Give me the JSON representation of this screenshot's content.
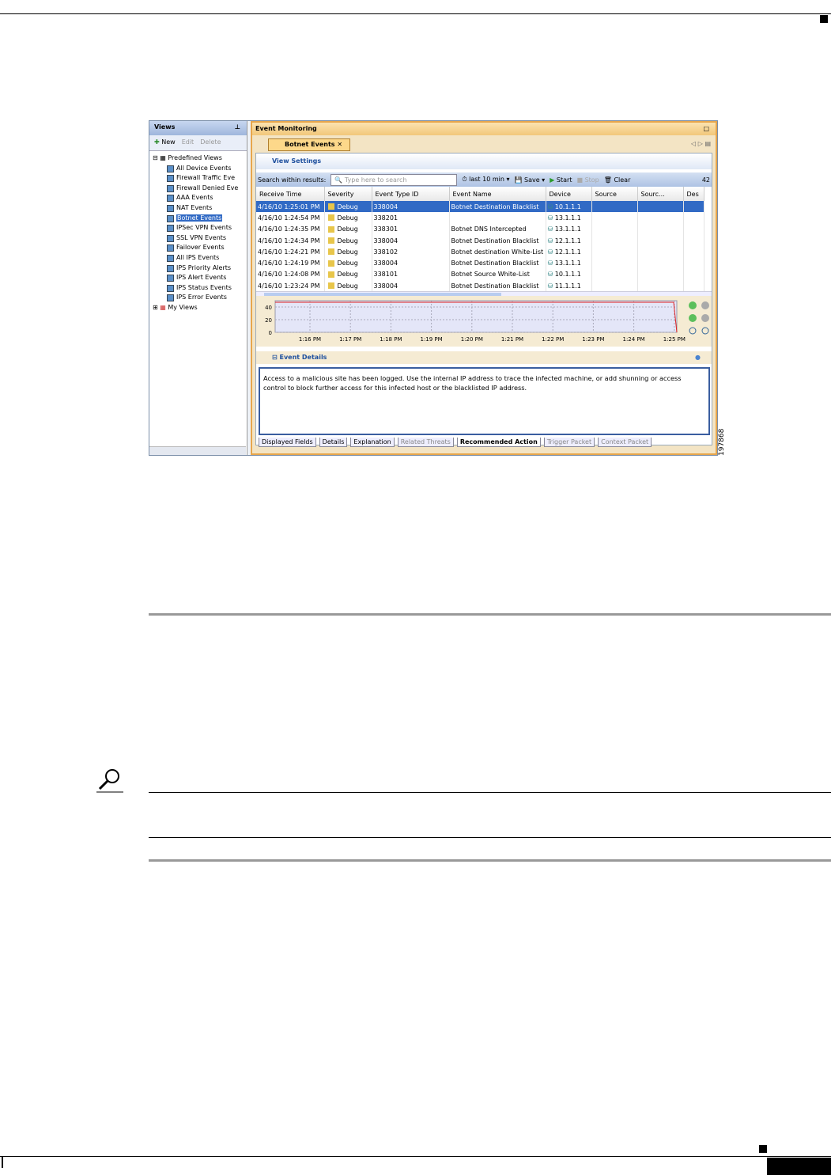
{
  "figure": {
    "left_panel": {
      "title": "Views",
      "toolbar": {
        "new": "New",
        "edit": "Edit",
        "delete": "Delete"
      },
      "tree": {
        "root": "Predefined Views",
        "items": [
          "All Device Events",
          "Firewall Traffic Eve",
          "Firewall Denied Eve",
          "AAA Events",
          "NAT Events",
          "Botnet Events",
          "IPSec VPN Events",
          "SSL VPN Events",
          "Failover Events",
          "All IPS Events",
          "IPS Priority Alerts",
          "IPS Alert Events",
          "IPS Status Events",
          "IPS Error Events"
        ],
        "selected": "Botnet Events",
        "my_views": "My Views"
      }
    },
    "right_panel": {
      "title": "Event Monitoring",
      "tab": "Botnet Events",
      "view_settings": "View Settings",
      "toolbar": {
        "search_label": "Search within results:",
        "search_placeholder": "Type here to search",
        "time": "last 10 min",
        "save": "Save",
        "start": "Start",
        "stop": "Stop",
        "clear": "Clear",
        "count": "42"
      },
      "columns": [
        "Receive Time",
        "Severity",
        "Event Type ID",
        "Event Name",
        "Device",
        "Source",
        "Sourc...",
        "Des"
      ],
      "rows": [
        [
          "4/16/10 1:25:01 PM",
          "Debug",
          "338004",
          "Botnet Destination Blacklist",
          "10.1.1.1"
        ],
        [
          "4/16/10 1:24:54 PM",
          "Debug",
          "338201",
          "",
          "13.1.1.1"
        ],
        [
          "4/16/10 1:24:35 PM",
          "Debug",
          "338301",
          "Botnet DNS Intercepted",
          "13.1.1.1"
        ],
        [
          "4/16/10 1:24:34 PM",
          "Debug",
          "338004",
          "Botnet Destination Blacklist",
          "12.1.1.1"
        ],
        [
          "4/16/10 1:24:21 PM",
          "Debug",
          "338102",
          "Botnet destination White-List",
          "12.1.1.1"
        ],
        [
          "4/16/10 1:24:19 PM",
          "Debug",
          "338004",
          "Botnet Destination Blacklist",
          "13.1.1.1"
        ],
        [
          "4/16/10 1:24:08 PM",
          "Debug",
          "338101",
          "Botnet Source White-List",
          "10.1.1.1"
        ],
        [
          "4/16/10 1:23:24 PM",
          "Debug",
          "338004",
          "Botnet Destination Blacklist",
          "11.1.1.1"
        ]
      ],
      "chart": {
        "yticks": [
          "40",
          "20",
          "0"
        ],
        "xticks": [
          "1:16 PM",
          "1:17 PM",
          "1:18 PM",
          "1:19 PM",
          "1:20 PM",
          "1:21 PM",
          "1:22 PM",
          "1:23 PM",
          "1:24 PM",
          "1:25 PM"
        ]
      },
      "event_details": {
        "title": "Event Details",
        "text": "Access to a malicious site has been logged. Use the internal IP address to trace the infected machine, or add shunning or access control to block further access for this infected host or the blacklisted IP address."
      },
      "bottom_tabs": [
        "Displayed Fields",
        "Details",
        "Explanation",
        "Related Threats",
        "Recommended Action",
        "Trigger Packet",
        "Context Packet"
      ],
      "active_bottom_tab": "Recommended Action"
    },
    "figure_number": "197868"
  }
}
